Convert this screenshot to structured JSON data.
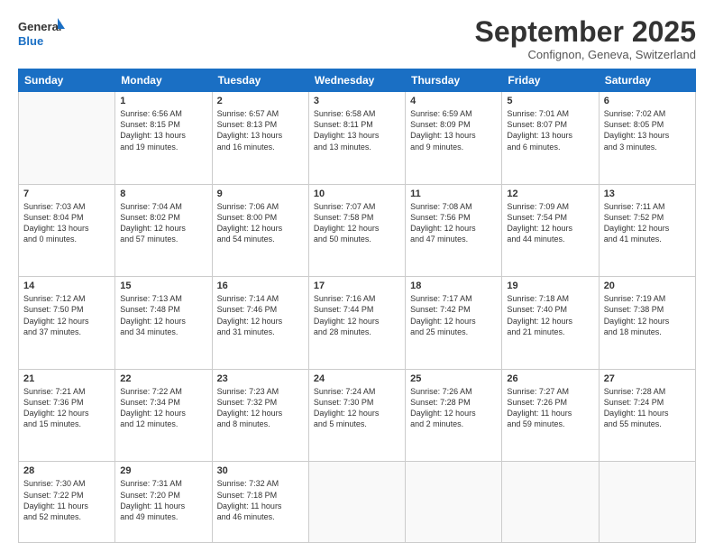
{
  "logo": {
    "general": "General",
    "blue": "Blue"
  },
  "header": {
    "month": "September 2025",
    "location": "Confignon, Geneva, Switzerland"
  },
  "days_of_week": [
    "Sunday",
    "Monday",
    "Tuesday",
    "Wednesday",
    "Thursday",
    "Friday",
    "Saturday"
  ],
  "weeks": [
    [
      {
        "day": "",
        "info": ""
      },
      {
        "day": "1",
        "info": "Sunrise: 6:56 AM\nSunset: 8:15 PM\nDaylight: 13 hours\nand 19 minutes."
      },
      {
        "day": "2",
        "info": "Sunrise: 6:57 AM\nSunset: 8:13 PM\nDaylight: 13 hours\nand 16 minutes."
      },
      {
        "day": "3",
        "info": "Sunrise: 6:58 AM\nSunset: 8:11 PM\nDaylight: 13 hours\nand 13 minutes."
      },
      {
        "day": "4",
        "info": "Sunrise: 6:59 AM\nSunset: 8:09 PM\nDaylight: 13 hours\nand 9 minutes."
      },
      {
        "day": "5",
        "info": "Sunrise: 7:01 AM\nSunset: 8:07 PM\nDaylight: 13 hours\nand 6 minutes."
      },
      {
        "day": "6",
        "info": "Sunrise: 7:02 AM\nSunset: 8:05 PM\nDaylight: 13 hours\nand 3 minutes."
      }
    ],
    [
      {
        "day": "7",
        "info": "Sunrise: 7:03 AM\nSunset: 8:04 PM\nDaylight: 13 hours\nand 0 minutes."
      },
      {
        "day": "8",
        "info": "Sunrise: 7:04 AM\nSunset: 8:02 PM\nDaylight: 12 hours\nand 57 minutes."
      },
      {
        "day": "9",
        "info": "Sunrise: 7:06 AM\nSunset: 8:00 PM\nDaylight: 12 hours\nand 54 minutes."
      },
      {
        "day": "10",
        "info": "Sunrise: 7:07 AM\nSunset: 7:58 PM\nDaylight: 12 hours\nand 50 minutes."
      },
      {
        "day": "11",
        "info": "Sunrise: 7:08 AM\nSunset: 7:56 PM\nDaylight: 12 hours\nand 47 minutes."
      },
      {
        "day": "12",
        "info": "Sunrise: 7:09 AM\nSunset: 7:54 PM\nDaylight: 12 hours\nand 44 minutes."
      },
      {
        "day": "13",
        "info": "Sunrise: 7:11 AM\nSunset: 7:52 PM\nDaylight: 12 hours\nand 41 minutes."
      }
    ],
    [
      {
        "day": "14",
        "info": "Sunrise: 7:12 AM\nSunset: 7:50 PM\nDaylight: 12 hours\nand 37 minutes."
      },
      {
        "day": "15",
        "info": "Sunrise: 7:13 AM\nSunset: 7:48 PM\nDaylight: 12 hours\nand 34 minutes."
      },
      {
        "day": "16",
        "info": "Sunrise: 7:14 AM\nSunset: 7:46 PM\nDaylight: 12 hours\nand 31 minutes."
      },
      {
        "day": "17",
        "info": "Sunrise: 7:16 AM\nSunset: 7:44 PM\nDaylight: 12 hours\nand 28 minutes."
      },
      {
        "day": "18",
        "info": "Sunrise: 7:17 AM\nSunset: 7:42 PM\nDaylight: 12 hours\nand 25 minutes."
      },
      {
        "day": "19",
        "info": "Sunrise: 7:18 AM\nSunset: 7:40 PM\nDaylight: 12 hours\nand 21 minutes."
      },
      {
        "day": "20",
        "info": "Sunrise: 7:19 AM\nSunset: 7:38 PM\nDaylight: 12 hours\nand 18 minutes."
      }
    ],
    [
      {
        "day": "21",
        "info": "Sunrise: 7:21 AM\nSunset: 7:36 PM\nDaylight: 12 hours\nand 15 minutes."
      },
      {
        "day": "22",
        "info": "Sunrise: 7:22 AM\nSunset: 7:34 PM\nDaylight: 12 hours\nand 12 minutes."
      },
      {
        "day": "23",
        "info": "Sunrise: 7:23 AM\nSunset: 7:32 PM\nDaylight: 12 hours\nand 8 minutes."
      },
      {
        "day": "24",
        "info": "Sunrise: 7:24 AM\nSunset: 7:30 PM\nDaylight: 12 hours\nand 5 minutes."
      },
      {
        "day": "25",
        "info": "Sunrise: 7:26 AM\nSunset: 7:28 PM\nDaylight: 12 hours\nand 2 minutes."
      },
      {
        "day": "26",
        "info": "Sunrise: 7:27 AM\nSunset: 7:26 PM\nDaylight: 11 hours\nand 59 minutes."
      },
      {
        "day": "27",
        "info": "Sunrise: 7:28 AM\nSunset: 7:24 PM\nDaylight: 11 hours\nand 55 minutes."
      }
    ],
    [
      {
        "day": "28",
        "info": "Sunrise: 7:30 AM\nSunset: 7:22 PM\nDaylight: 11 hours\nand 52 minutes."
      },
      {
        "day": "29",
        "info": "Sunrise: 7:31 AM\nSunset: 7:20 PM\nDaylight: 11 hours\nand 49 minutes."
      },
      {
        "day": "30",
        "info": "Sunrise: 7:32 AM\nSunset: 7:18 PM\nDaylight: 11 hours\nand 46 minutes."
      },
      {
        "day": "",
        "info": ""
      },
      {
        "day": "",
        "info": ""
      },
      {
        "day": "",
        "info": ""
      },
      {
        "day": "",
        "info": ""
      }
    ]
  ]
}
